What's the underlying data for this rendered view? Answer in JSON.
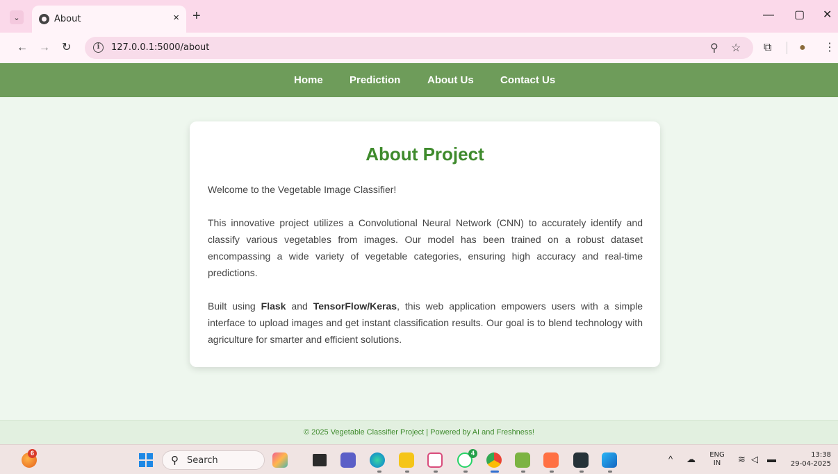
{
  "browser": {
    "tab_title": "About",
    "tab_close": "×",
    "new_tab": "+",
    "url": "127.0.0.1:5000/about",
    "icons": [
      "tab-list-icon",
      "globe-icon",
      "close-icon",
      "plus-icon",
      "minimize-icon",
      "restore-icon",
      "back-icon",
      "forward-icon",
      "reload-icon",
      "info-icon",
      "zoom-icon",
      "star-icon",
      "extensions-icon",
      "profile-icon",
      "menu-icon"
    ]
  },
  "site_nav": {
    "items": [
      "Home",
      "Prediction",
      "About Us",
      "Contact Us"
    ]
  },
  "about": {
    "title": "About Project",
    "welcome": "Welcome to the Vegetable Image Classifier!",
    "paragraph1": "This innovative project utilizes a Convolutional Neural Network (CNN) to accurately identify and classify various vegetables from images. Our model has been trained on a robust dataset encompassing a wide variety of vegetable categories, ensuring high accuracy and real-time predictions.",
    "p2_prefix": "Built using ",
    "p2_flask": "Flask",
    "p2_and": " and ",
    "p2_tf": "TensorFlow/Keras",
    "p2_rest": ", this web application empowers users with a simple interface to upload images and get instant classification results. Our goal is to blend technology with agriculture for smarter and efficient solutions."
  },
  "footer": {
    "text": "© 2025 Vegetable Classifier Project | Powered by AI and Freshness!"
  },
  "taskbar": {
    "notification_count": "6",
    "search_label": "Search",
    "whatsapp_badge": "4",
    "lang_top": "ENG",
    "lang_bottom": "IN",
    "time": "13:38",
    "date": "29-04-2025"
  },
  "colors": {
    "nav_bg": "#6e9c5a",
    "accent_green": "#3e8a2c",
    "page_bg": "#eef7ee",
    "tab_strip": "#fbd9ea"
  }
}
